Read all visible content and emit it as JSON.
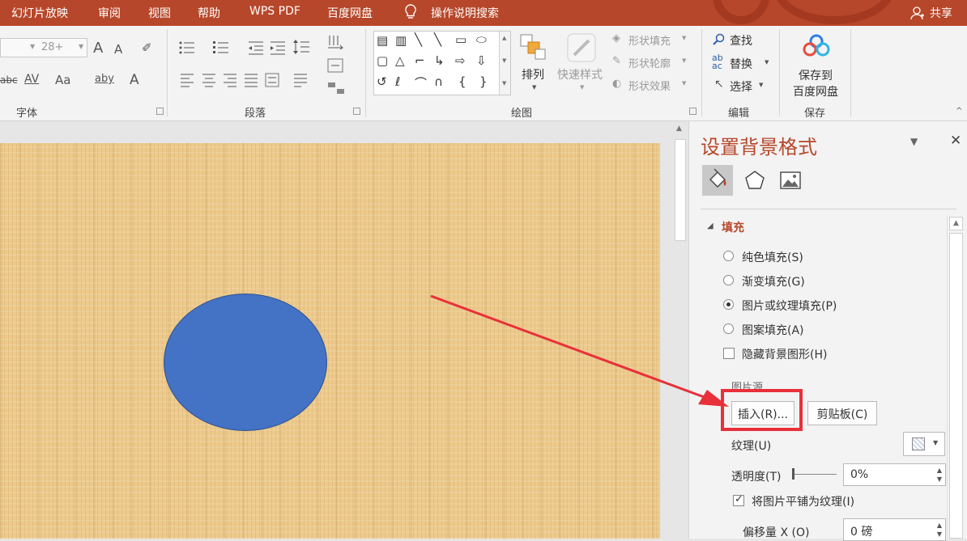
{
  "tabs": {
    "slideshow": "幻灯片放映",
    "review": "审阅",
    "view": "视图",
    "help": "帮助",
    "wps_pdf": "WPS PDF",
    "baidu_pan": "百度网盘",
    "tell_me": "操作说明搜索",
    "share": "共享"
  },
  "ribbon": {
    "font": {
      "label": "字体",
      "size_value": "28+",
      "grow": "A",
      "shrink": "A",
      "abc": "abc",
      "spacing": "AV",
      "case": "Aa",
      "highlight": "aby",
      "color": "A"
    },
    "paragraph": {
      "label": "段落"
    },
    "drawing": {
      "label": "绘图",
      "arrange": "排列",
      "quick_styles": "快速样式",
      "shape_fill": "形状填充",
      "shape_outline": "形状轮廓",
      "shape_effects": "形状效果"
    },
    "editing": {
      "label": "编辑",
      "find": "查找",
      "replace": "替换",
      "select": "选择"
    },
    "save": {
      "label": "保存",
      "save_to_line1": "保存到",
      "save_to_line2": "百度网盘"
    }
  },
  "pane": {
    "title": "设置背景格式",
    "section_fill": "填充",
    "options": [
      {
        "label": "纯色填充(S)",
        "checked": false
      },
      {
        "label": "渐变填充(G)",
        "checked": false
      },
      {
        "label": "图片或纹理填充(P)",
        "checked": true
      },
      {
        "label": "图案填充(A)",
        "checked": false
      }
    ],
    "hide_background": "隐藏背景图形(H)",
    "picture_source": "图片源",
    "insert_button": "插入(R)...",
    "clipboard_button": "剪贴板(C)",
    "texture_label": "纹理(U)",
    "transparency_label": "透明度(T)",
    "transparency_value": "0%",
    "tile_label": "将图片平铺为纹理(I)",
    "tile_checked": true,
    "offset_x_label": "偏移量 X (O)",
    "offset_x_value": "0 磅"
  },
  "colors": {
    "accent": "#b7472a",
    "shape_fill": "#4472c4",
    "annotation": "#e8303a"
  }
}
